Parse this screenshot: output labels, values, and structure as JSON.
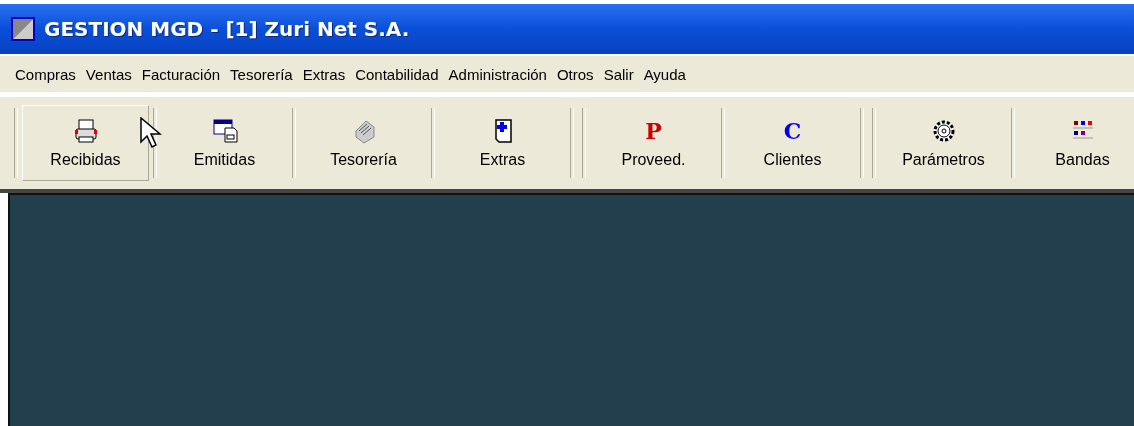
{
  "window": {
    "title": "GESTION MGD - [1] Zuri Net S.A."
  },
  "menu": [
    "Compras",
    "Ventas",
    "Facturación",
    "Tesorería",
    "Extras",
    "Contabilidad",
    "Administración",
    "Otros",
    "Salir",
    "Ayuda"
  ],
  "toolbar": {
    "groups": [
      [
        {
          "label": "Recibidas",
          "kind": "printer",
          "raised": true
        },
        {
          "label": "Emitidas",
          "kind": "document",
          "raised": false
        },
        {
          "label": "Tesorería",
          "kind": "fax",
          "raised": false
        },
        {
          "label": "Extras",
          "kind": "plus-page",
          "raised": false
        }
      ],
      [
        {
          "label": "Proveed.",
          "kind": "letter",
          "glyph": "P",
          "color": "#cc0000",
          "raised": false
        },
        {
          "label": "Clientes",
          "kind": "letter",
          "glyph": "C",
          "color": "#0000ee",
          "raised": false
        }
      ],
      [
        {
          "label": "Parámetros",
          "kind": "gear",
          "raised": false
        },
        {
          "label": "Bandas",
          "kind": "palette",
          "raised": false
        }
      ]
    ]
  }
}
